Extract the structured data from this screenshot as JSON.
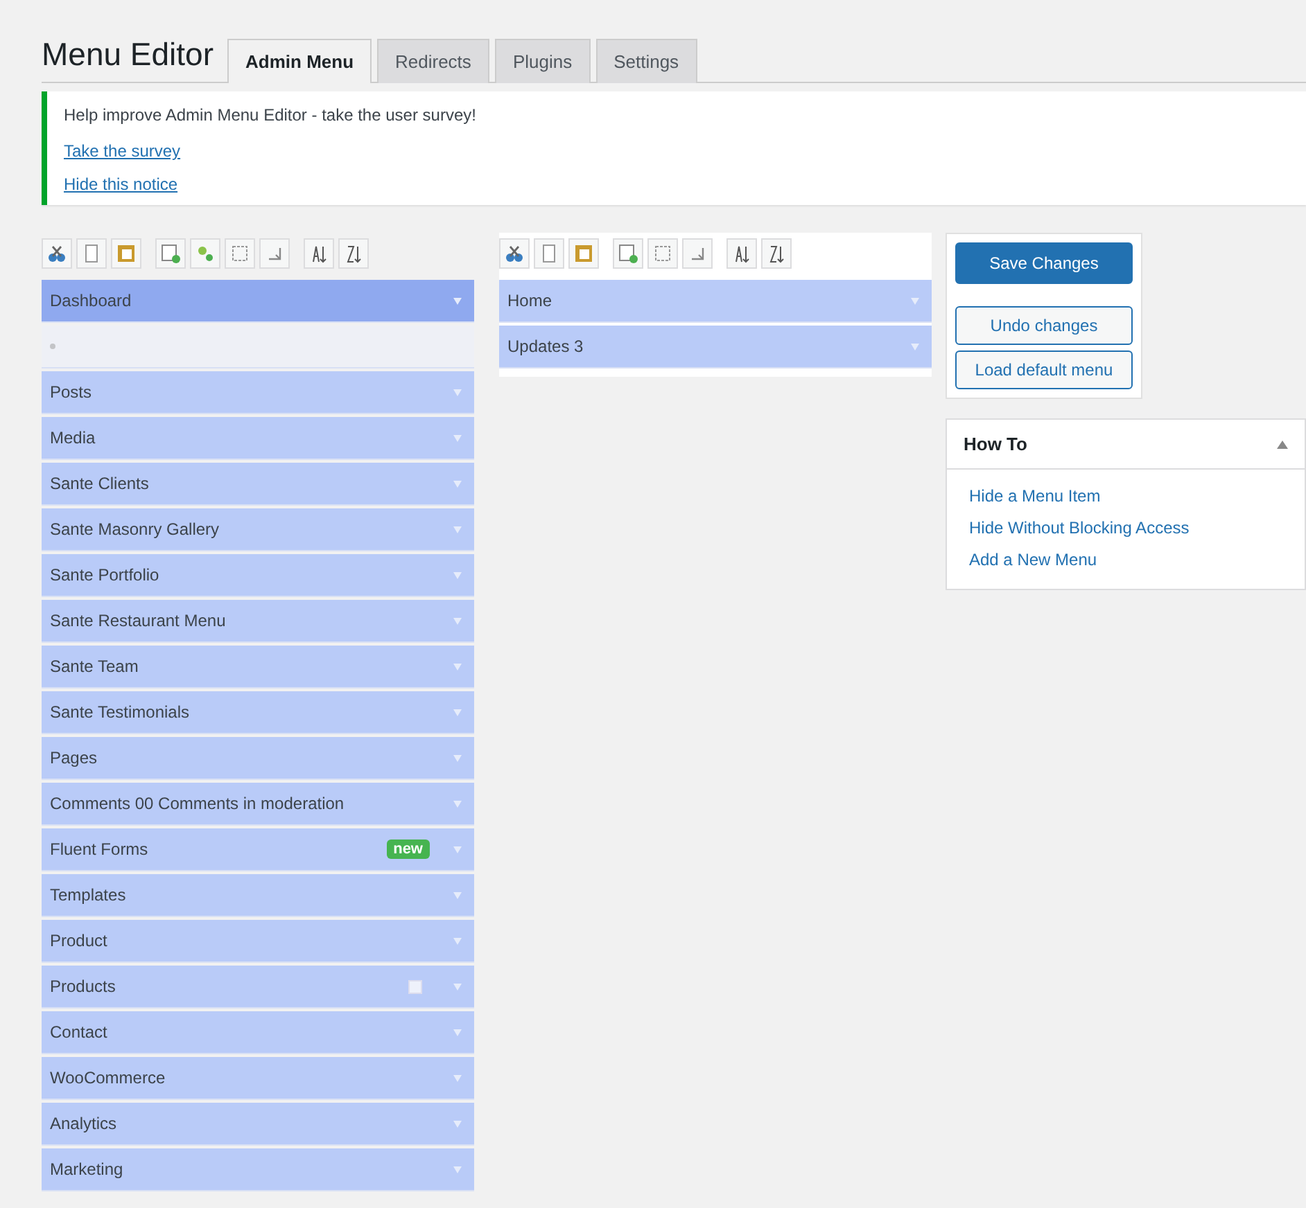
{
  "title": "Menu Editor",
  "tabs": [
    {
      "label": "Admin Menu",
      "selected": true
    },
    {
      "label": "Redirects",
      "selected": false
    },
    {
      "label": "Plugins",
      "selected": false
    },
    {
      "label": "Settings",
      "selected": false
    }
  ],
  "notice": {
    "text": "Help improve Admin Menu Editor - take the user survey!",
    "links": [
      "Take the survey",
      "Hide this notice"
    ]
  },
  "top_menu": [
    {
      "kind": "item",
      "label": "Dashboard",
      "selected": true
    },
    {
      "kind": "separator",
      "selected": false
    },
    {
      "kind": "item",
      "label": "Posts",
      "selected": false
    },
    {
      "kind": "item",
      "label": "Media",
      "selected": false
    },
    {
      "kind": "item",
      "label": "Sante Clients",
      "selected": false
    },
    {
      "kind": "item",
      "label": "Sante Masonry Gallery",
      "selected": false
    },
    {
      "kind": "item",
      "label": "Sante Portfolio",
      "selected": false
    },
    {
      "kind": "item",
      "label": "Sante Restaurant Menu",
      "selected": false
    },
    {
      "kind": "item",
      "label": "Sante Team",
      "selected": false
    },
    {
      "kind": "item",
      "label": "Sante Testimonials",
      "selected": false
    },
    {
      "kind": "item",
      "label": "Pages",
      "selected": false
    },
    {
      "kind": "item",
      "label": "Comments 00 Comments in moderation",
      "selected": false
    },
    {
      "kind": "item",
      "label": "Fluent Forms",
      "badge": "new",
      "selected": false
    },
    {
      "kind": "item",
      "label": "Templates",
      "selected": false
    },
    {
      "kind": "item",
      "label": "Product",
      "selected": false
    },
    {
      "kind": "item",
      "label": "Products",
      "has_icon": true,
      "selected": false
    },
    {
      "kind": "item",
      "label": "Contact",
      "selected": false
    },
    {
      "kind": "item",
      "label": "WooCommerce",
      "selected": false
    },
    {
      "kind": "item",
      "label": "Analytics",
      "selected": false
    },
    {
      "kind": "item",
      "label": "Marketing",
      "selected": false
    }
  ],
  "submenu": [
    {
      "label": "Home",
      "selected": false
    },
    {
      "label": "Updates 3",
      "selected": false
    }
  ],
  "buttons": {
    "save": "Save Changes",
    "undo": "Undo changes",
    "load_default": "Load default menu"
  },
  "how_to": {
    "title": "How To",
    "links": [
      "Hide a Menu Item",
      "Hide Without Blocking Access",
      "Add a New Menu"
    ]
  }
}
